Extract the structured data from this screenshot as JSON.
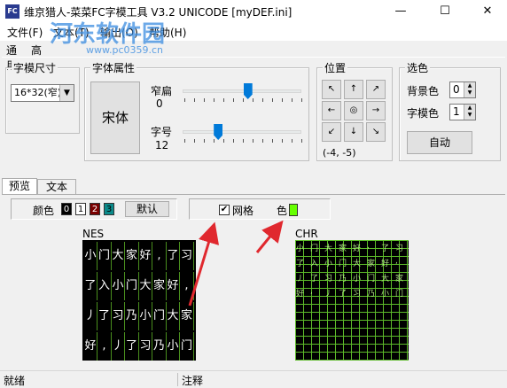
{
  "window": {
    "title": "维京猎人-菜菜FC字模工具 V3.2 UNICODE   [myDEF.ini]",
    "icon_name": "app-icon",
    "controls": {
      "minimize": "—",
      "maximize": "☐",
      "close": "✕"
    }
  },
  "menu": [
    "文件(F)",
    "文本(T)",
    "输出(O)",
    "帮助(H)"
  ],
  "top_tabs": [
    "通用",
    "高级"
  ],
  "font_size_group": {
    "title": "字模尺寸",
    "selected": "16*32(窄)"
  },
  "font_attr_group": {
    "title": "字体属性",
    "font_button": "宋体",
    "narrow_label": "窄扁",
    "narrow_value": "0",
    "narrow_level": 0.55,
    "size_label": "字号",
    "size_value": "12",
    "size_level": 0.3
  },
  "position_group": {
    "title": "位置",
    "buttons": [
      "↖",
      "↑",
      "↗",
      "←",
      "◎",
      "→",
      "↙",
      "↓",
      "↘"
    ],
    "coords": "(-4, -5)"
  },
  "color_group": {
    "title": "选色",
    "bg_label": "背景色",
    "bg_value": "0",
    "fg_label": "字模色",
    "fg_value": "1",
    "auto_button": "自动"
  },
  "bottom_tabs": [
    "预览",
    "文本"
  ],
  "preview": {
    "color_label": "颜色",
    "swatches": [
      {
        "label": "0",
        "color": "#000000",
        "text_color": "#ffffff"
      },
      {
        "label": "1",
        "color": "#ffffff",
        "text_color": "#000000"
      },
      {
        "label": "2",
        "color": "#7a0000",
        "text_color": "#ffffff"
      },
      {
        "label": "3",
        "color": "#0a8a8a",
        "text_color": "#000000"
      }
    ],
    "default_button": "默认",
    "grid_checkbox_label": "网格",
    "grid_checked": true,
    "grid_color_label": "色",
    "grid_color": "#66ff00",
    "nes_label": "NES",
    "chr_label": "CHR",
    "nes_rows": [
      "小门大家好,了习",
      "了入小门大家好,",
      "丿了习乃小门大家",
      "好,丿了习乃小门"
    ]
  },
  "status": {
    "left": "就绪",
    "right": "注释"
  },
  "watermark": {
    "text": "河东软件园",
    "url": "www.pc0359.cn"
  },
  "colors": {
    "accent": "#007ad9",
    "grid_green": "#5dbb2a",
    "annotation_red": "#e0282e"
  }
}
